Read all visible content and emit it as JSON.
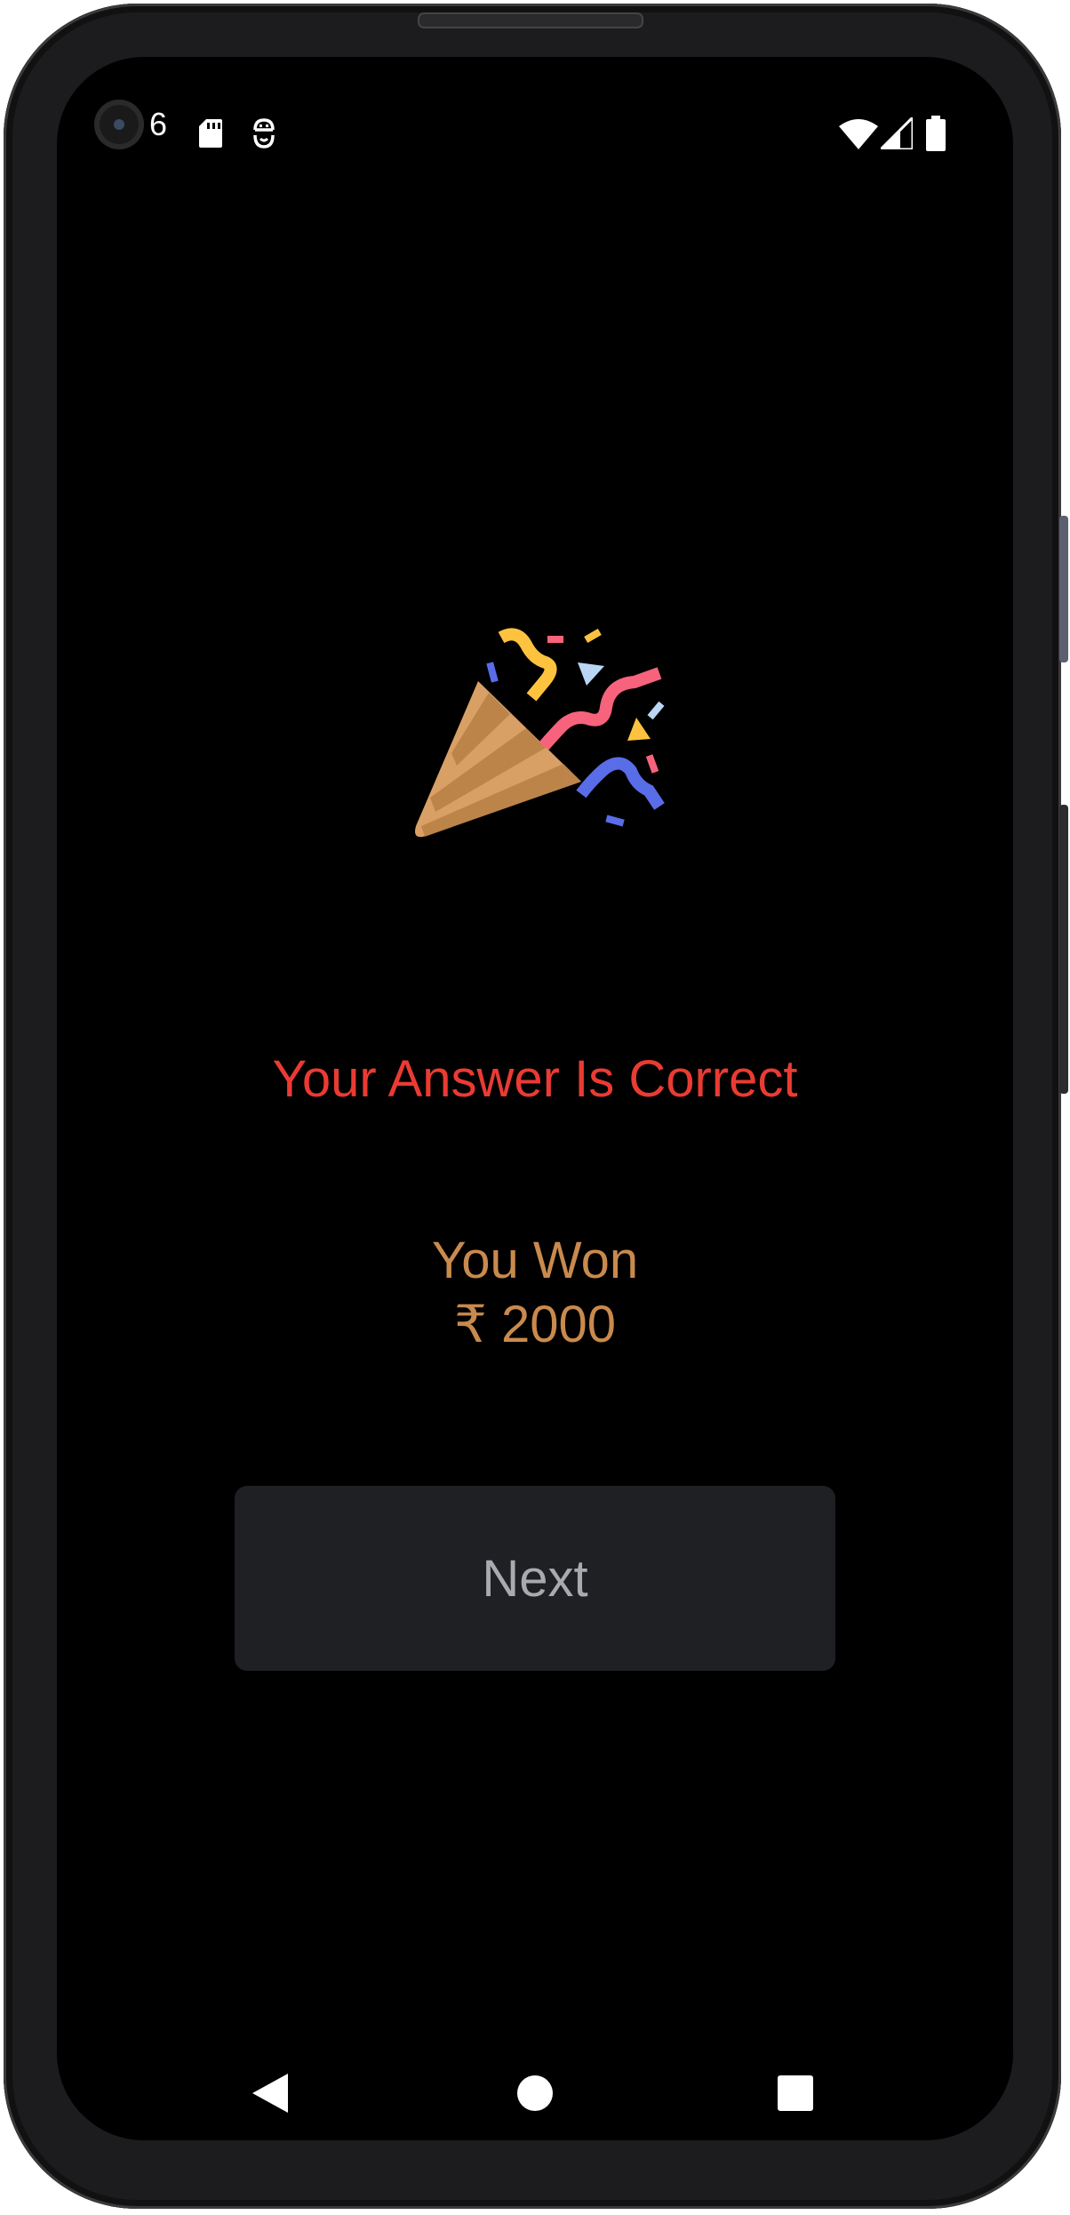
{
  "status_bar": {
    "time": "6",
    "left_icons": [
      "sd-card-icon",
      "accessibility-icon"
    ],
    "right_icons": [
      "wifi-icon",
      "cellular-signal-icon",
      "battery-icon"
    ]
  },
  "result": {
    "icon": "party-popper-icon",
    "title": "Your Answer Is Correct",
    "title_color": "#ea3b33",
    "won_label": "You Won",
    "amount": "₹ 2000",
    "prize_color": "#c98a4d"
  },
  "actions": {
    "next_label": "Next"
  },
  "nav_bar": {
    "buttons": [
      "back-icon",
      "home-icon",
      "recents-icon"
    ]
  }
}
